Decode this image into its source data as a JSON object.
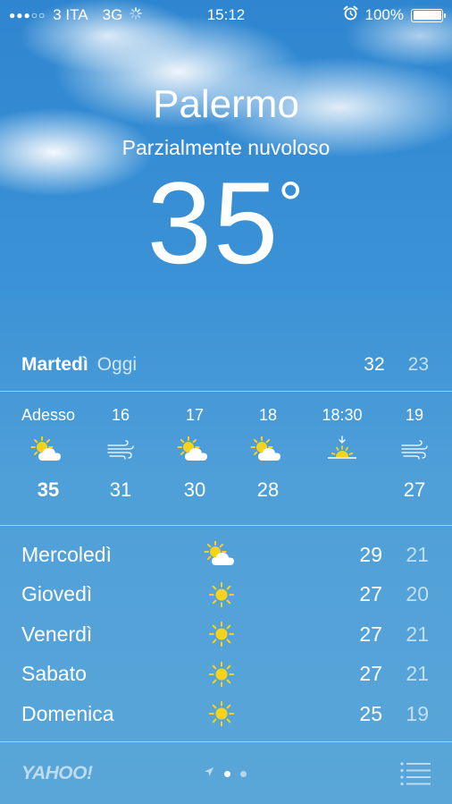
{
  "status_bar": {
    "signal_dots": "●●●○○",
    "carrier": "3 ITA",
    "network": "3G",
    "time": "15:12",
    "battery": "100%"
  },
  "location": {
    "city": "Palermo",
    "condition": "Parzialmente nuvoloso",
    "temperature": "35",
    "degree": "°"
  },
  "today": {
    "day": "Martedì",
    "label": "Oggi",
    "high": "32",
    "low": "23"
  },
  "hourly": [
    {
      "time": "Adesso",
      "icon": "partly-cloudy-icon",
      "temp": "35"
    },
    {
      "time": "16",
      "icon": "wind-icon",
      "temp": "31"
    },
    {
      "time": "17",
      "icon": "partly-cloudy-icon",
      "temp": "30"
    },
    {
      "time": "18",
      "icon": "partly-cloudy-icon",
      "temp": "28"
    },
    {
      "time": "18:30",
      "icon": "sunset-icon",
      "temp": ""
    },
    {
      "time": "19",
      "icon": "wind-icon",
      "temp": "27"
    }
  ],
  "daily": [
    {
      "day": "Mercoledì",
      "icon": "partly-cloudy-icon",
      "high": "29",
      "low": "21"
    },
    {
      "day": "Giovedì",
      "icon": "sun-icon",
      "high": "27",
      "low": "20"
    },
    {
      "day": "Venerdì",
      "icon": "sun-icon",
      "high": "27",
      "low": "21"
    },
    {
      "day": "Sabato",
      "icon": "sun-icon",
      "high": "27",
      "low": "21"
    },
    {
      "day": "Domenica",
      "icon": "sun-icon",
      "high": "25",
      "low": "19"
    }
  ],
  "footer": {
    "brand": "YAHOO!",
    "pages": 2,
    "active_page": 1
  },
  "colors": {
    "sun": "#f7d21b",
    "cloud": "#ffffff",
    "sky_top": "#2f86d0",
    "sky_bottom": "#5aa6d8"
  }
}
